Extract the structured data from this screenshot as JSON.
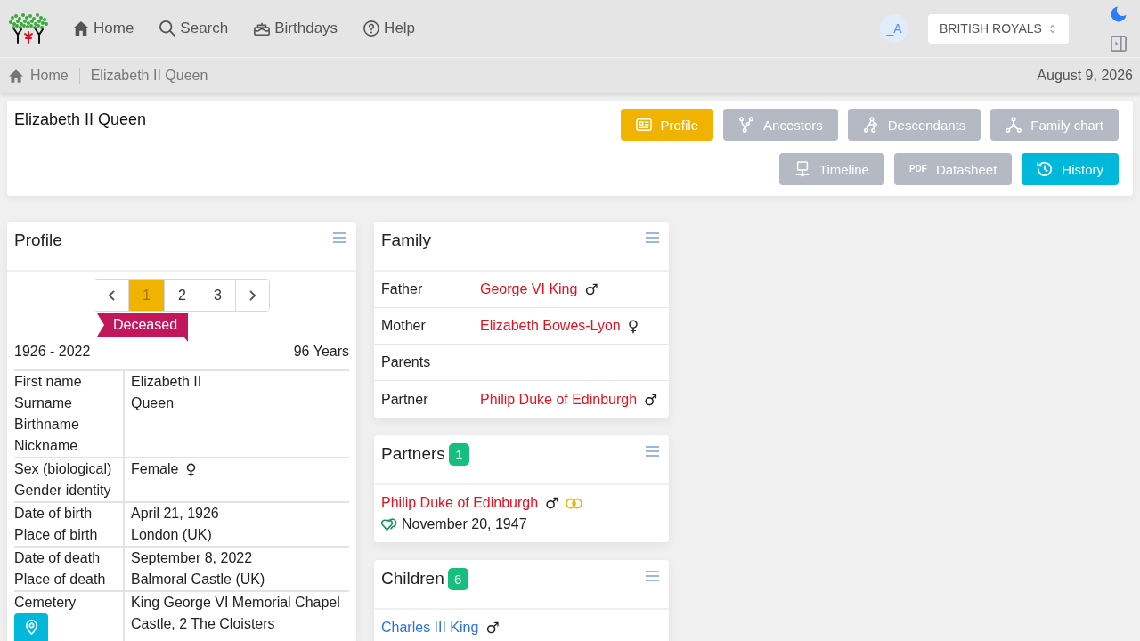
{
  "header": {
    "nav": [
      {
        "kind": "home",
        "label": "Home"
      },
      {
        "kind": "search",
        "label": "Search"
      },
      {
        "kind": "birthdays",
        "label": "Birthdays"
      },
      {
        "kind": "help",
        "label": "Help"
      }
    ],
    "avatar": "_A",
    "tree_selector": {
      "value": "BRITISH ROYALS"
    }
  },
  "breadcrumb": {
    "home": "Home",
    "current": "Elizabeth II Queen",
    "date": "August 9, 2026"
  },
  "person_header": {
    "title": "Elizabeth II Queen",
    "buttons": [
      {
        "kind": "profile",
        "label": "Profile",
        "color": "#f0b400"
      },
      {
        "kind": "ancestors",
        "label": "Ancestors",
        "color": "#b4b9c3"
      },
      {
        "kind": "descendants",
        "label": "Descendants",
        "color": "#b4b9c3"
      },
      {
        "kind": "family_chart",
        "label": "Family chart",
        "color": "#b4b9c3"
      },
      {
        "kind": "timeline",
        "label": "Timeline",
        "color": "#b4b9c3"
      },
      {
        "kind": "datasheet",
        "label": "Datasheet",
        "icon_text": "PDF",
        "color": "#b4b9c3"
      },
      {
        "kind": "history",
        "label": "History",
        "color": "#00b8d9"
      }
    ]
  },
  "profile": {
    "title": "Profile",
    "pages": [
      {
        "label": "1",
        "selected": true
      },
      {
        "label": "2",
        "selected": false
      },
      {
        "label": "3",
        "selected": false
      }
    ],
    "status": "Deceased",
    "years": "1926 - 2022",
    "age": "96 Years",
    "groups": [
      {
        "rows": [
          {
            "label": "First name",
            "value": "Elizabeth II"
          },
          {
            "label": "Surname",
            "value": "Queen"
          },
          {
            "label": "Birthname"
          },
          {
            "label": "Nickname"
          }
        ]
      },
      {
        "rows": [
          {
            "label": "Sex (biological)",
            "value": "Female",
            "symbol": "♀"
          },
          {
            "label": "Gender identity"
          }
        ]
      },
      {
        "rows": [
          {
            "label": "Date of birth",
            "value": "April 21, 1926"
          },
          {
            "label": "Place of birth",
            "value": "London (UK)"
          }
        ]
      },
      {
        "rows": [
          {
            "label": "Date of death",
            "value": "September 8, 2022"
          },
          {
            "label": "Place of death",
            "value": "Balmoral Castle (UK)"
          }
        ]
      },
      {
        "rows": [
          {
            "label": "Cemetery",
            "value": "King George VI Memorial Chapel Castle, 2 The Cloisters",
            "map_button": true
          }
        ]
      }
    ]
  },
  "family": {
    "title": "Family",
    "rows": [
      {
        "label": "Father",
        "person": {
          "name": "George VI King",
          "symbol": "♂",
          "color": "#e8101f"
        }
      },
      {
        "label": "Mother",
        "person": {
          "name": "Elizabeth Bowes-Lyon",
          "symbol": "♀",
          "color": "#e8101f"
        }
      },
      {
        "label": "Parents"
      },
      {
        "label": "Partner",
        "person": {
          "name": "Philip Duke of Edinburgh",
          "symbol": "♂",
          "color": "#e8101f"
        }
      }
    ]
  },
  "partners": {
    "title": "Partners",
    "count": "1",
    "items": [
      {
        "name": "Philip Duke of Edinburgh",
        "symbol": "♂",
        "color": "#e8101f",
        "married": true,
        "date": "November 20, 1947"
      }
    ]
  },
  "children": {
    "title": "Children",
    "count": "6",
    "items": [
      {
        "name": "Charles III King",
        "symbol": "♂",
        "color": "#2f6fe4"
      }
    ]
  }
}
